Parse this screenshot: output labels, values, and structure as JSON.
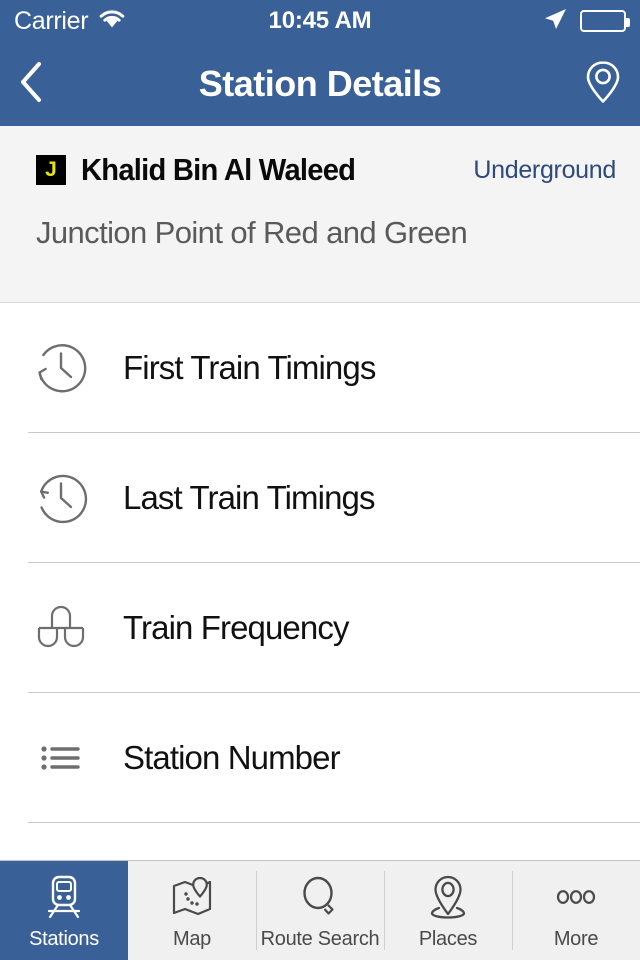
{
  "status_bar": {
    "carrier": "Carrier",
    "time": "10:45 AM",
    "wifi_icon": "wifi-icon",
    "location_icon": "location-arrow-icon",
    "battery_icon": "battery-icon"
  },
  "nav_bar": {
    "title": "Station Details",
    "back_icon": "chevron-left-icon",
    "map_pin_icon": "map-pin-icon"
  },
  "station_info": {
    "line_badge": "J",
    "badge_bg": "#000000",
    "badge_color": "#E8E40F",
    "name": "Khalid Bin Al Waleed",
    "type": "Underground",
    "type_color": "#2C4A7C",
    "subtitle": "Junction Point of Red and Green"
  },
  "detail_rows": [
    {
      "label": "First Train Timings",
      "icon": "clock-counterclockwise-icon"
    },
    {
      "label": "Last Train Timings",
      "icon": "clock-counterclockwise-icon"
    },
    {
      "label": "Train Frequency",
      "icon": "frequency-arch-icon"
    },
    {
      "label": "Station Number",
      "icon": "bulleted-list-icon"
    }
  ],
  "tab_bar": {
    "accent": "#3A6098",
    "items": [
      {
        "label": "Stations",
        "icon": "train-icon",
        "active": true
      },
      {
        "label": "Map",
        "icon": "folded-map-icon",
        "active": false
      },
      {
        "label": "Route Search",
        "icon": "magnifier-icon",
        "active": false
      },
      {
        "label": "Places",
        "icon": "place-pin-icon",
        "active": false
      },
      {
        "label": "More",
        "icon": "ellipsis-icon",
        "active": false
      }
    ]
  }
}
